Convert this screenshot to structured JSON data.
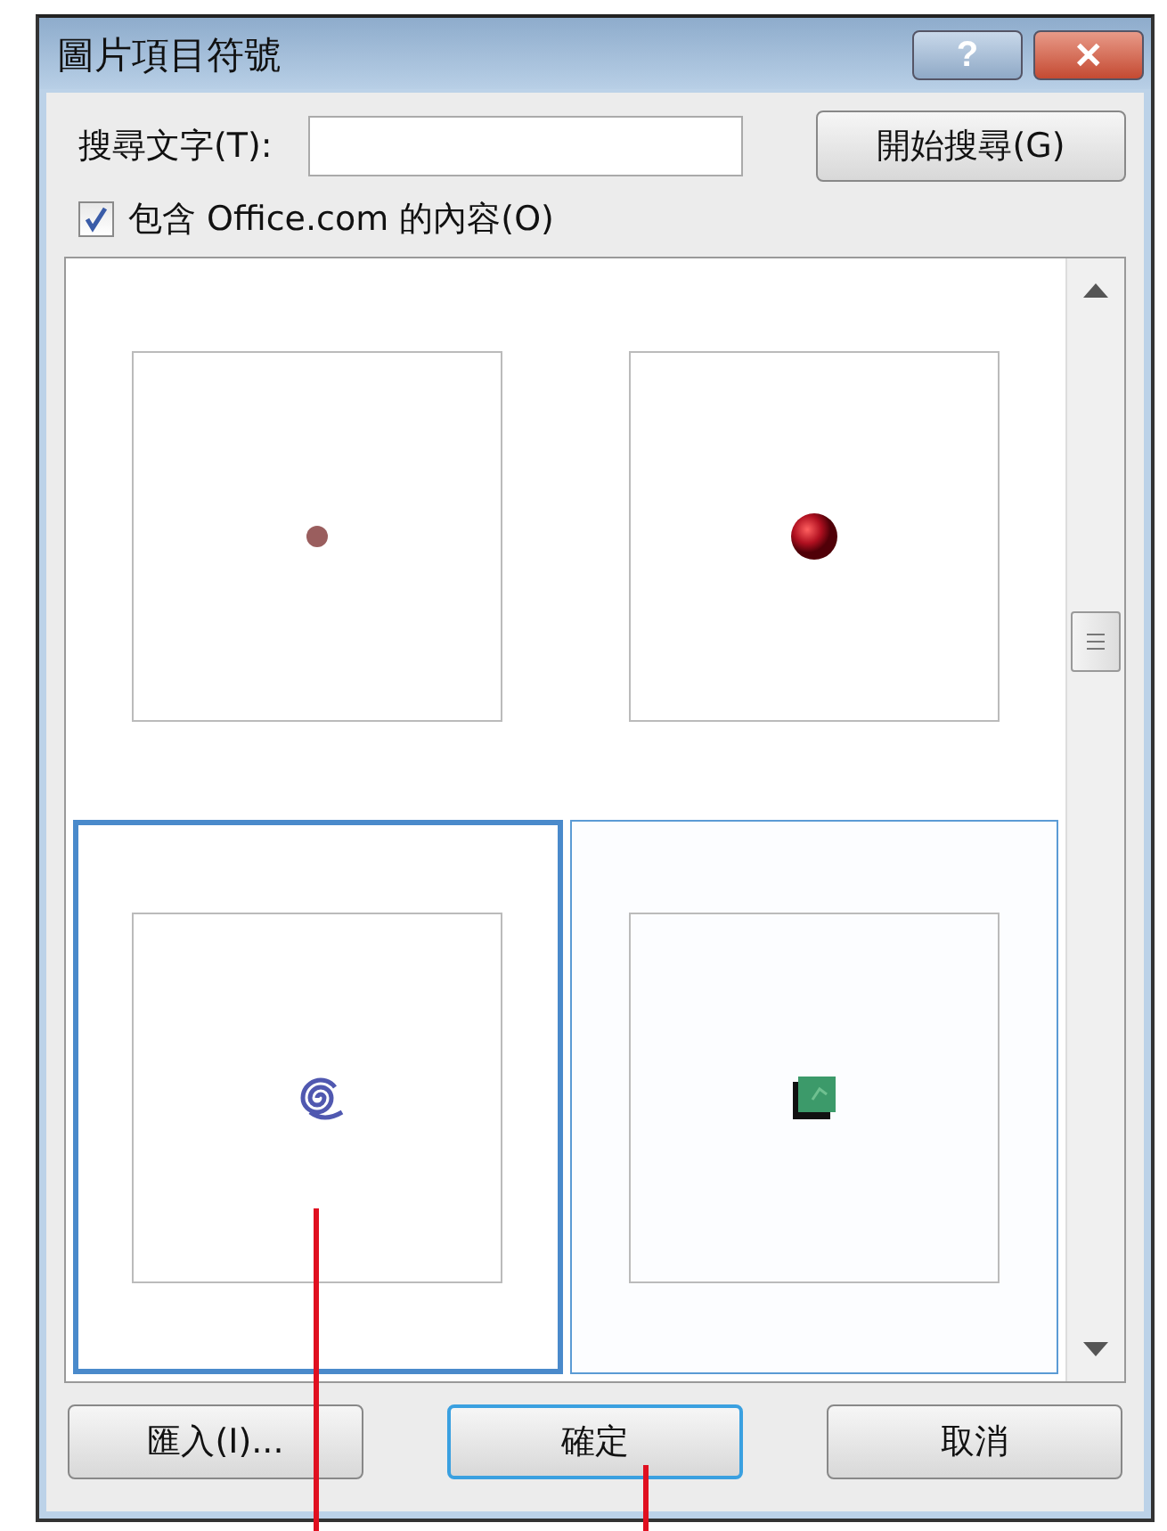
{
  "window": {
    "title": "圖片項目符號",
    "help_button": "?",
    "close_button": "✕"
  },
  "search": {
    "label": "搜尋文字(T):",
    "button": "開始搜尋(G)"
  },
  "include_office": {
    "label": "包含 Office.com 的內容(O)",
    "checked": true
  },
  "bullets": [
    {
      "kind": "dot",
      "selected": false,
      "hovered": false
    },
    {
      "kind": "sphere",
      "selected": false,
      "hovered": false
    },
    {
      "kind": "spiral",
      "selected": true,
      "hovered": false
    },
    {
      "kind": "cube",
      "selected": false,
      "hovered": true
    }
  ],
  "buttons": [
    {
      "label": "匯入(I)...",
      "default": false
    },
    {
      "label": "確定",
      "default": true
    },
    {
      "label": "取消",
      "default": false
    }
  ]
}
